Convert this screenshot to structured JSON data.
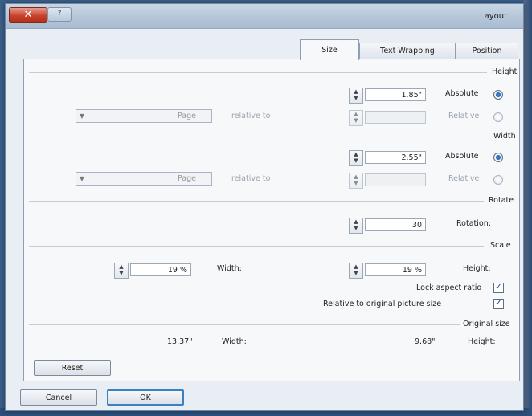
{
  "window": {
    "title": "Layout",
    "close_glyph": "✕",
    "help_glyph": "?"
  },
  "tabs": [
    {
      "label": "Position"
    },
    {
      "label": "Text Wrapping"
    },
    {
      "label": "Size",
      "active": true
    }
  ],
  "height": {
    "section_title": "Height",
    "absolute_label": "Absolute",
    "absolute_value": "1.85\"",
    "relative_label": "Relative",
    "relative_to_label": "relative to",
    "relative_to_value": "Page"
  },
  "width": {
    "section_title": "Width",
    "absolute_label": "Absolute",
    "absolute_value": "2.55\"",
    "relative_label": "Relative",
    "relative_to_label": "relative to",
    "relative_to_value": "Page"
  },
  "rotate": {
    "section_title": "Rotate",
    "rotation_label": "Rotation:",
    "rotation_value": "30"
  },
  "scale": {
    "section_title": "Scale",
    "height_label": "Height:",
    "height_value": "19 %",
    "width_label": "Width:",
    "width_value": "19 %",
    "lock_aspect_label": "Lock aspect ratio",
    "relative_original_label": "Relative to original picture size",
    "check_glyph": "✓"
  },
  "original_size": {
    "section_title": "Original size",
    "height_label": "Height:",
    "height_value": "9.68\"",
    "width_label": "Width:",
    "width_value": "13.37\""
  },
  "buttons": {
    "reset": "Reset",
    "ok": "OK",
    "cancel": "Cancel"
  },
  "icons": {
    "spin": "spin-arrows-icon",
    "dropdown": "chevron-down-icon"
  },
  "colors": {
    "accent": "#3c7fc4",
    "close": "#c8412a",
    "desktop": "#3b5f88"
  }
}
